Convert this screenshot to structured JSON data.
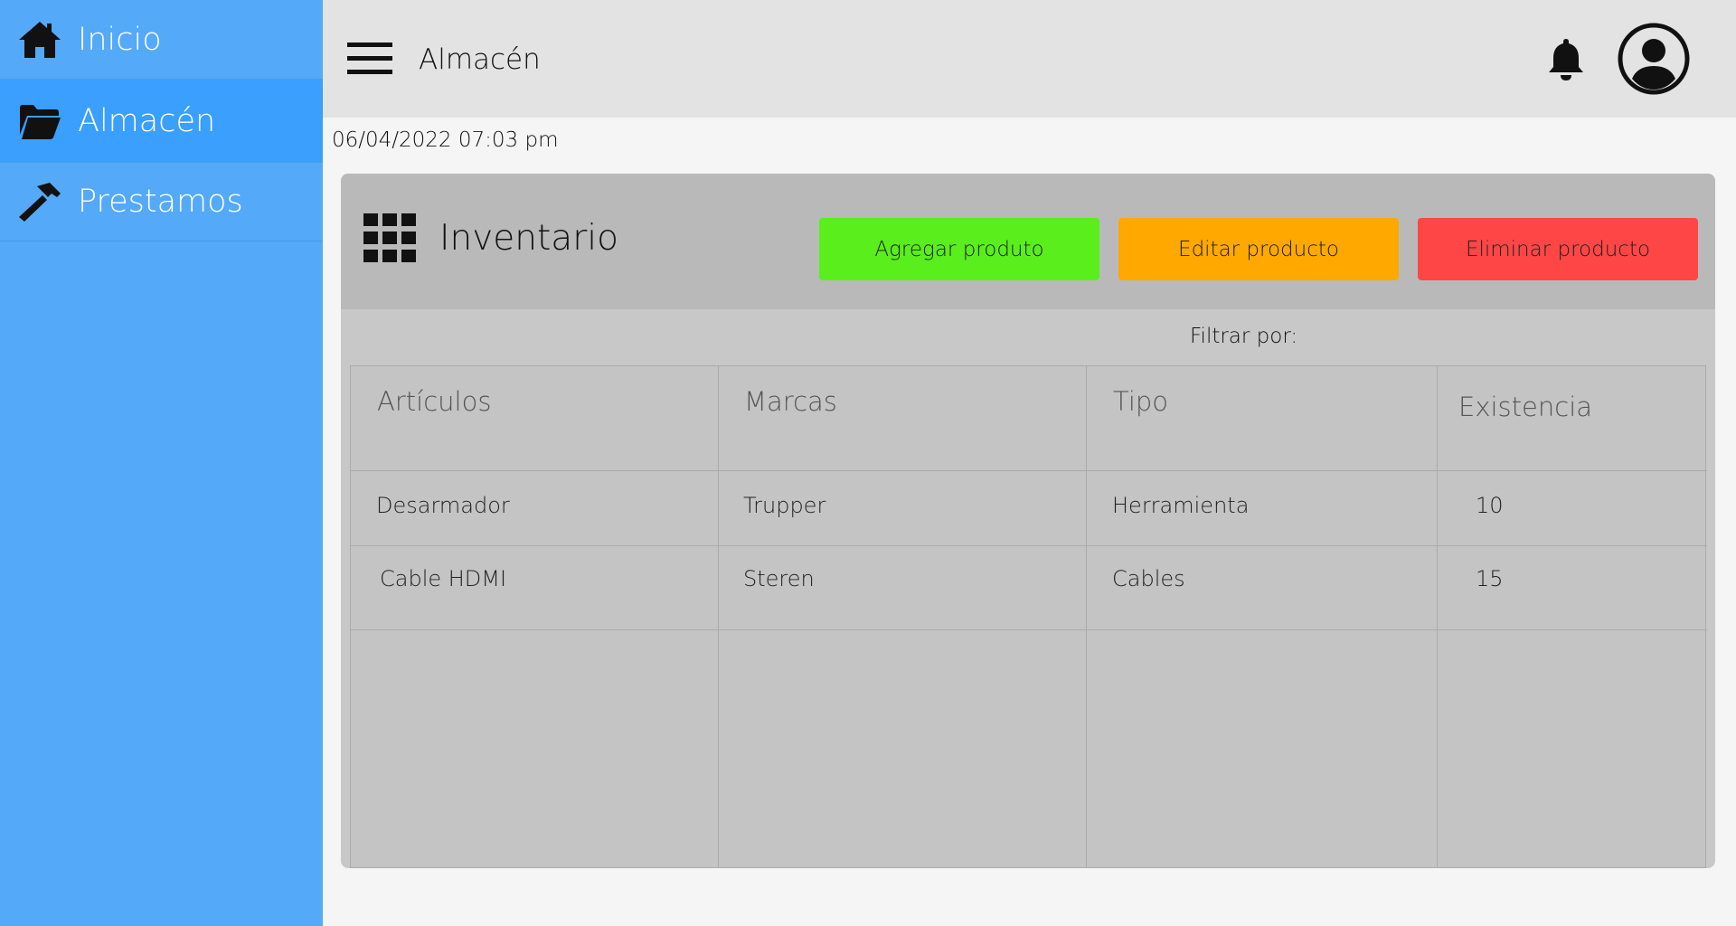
{
  "sidebar": {
    "items": [
      {
        "label": "Inicio",
        "icon": "home-icon",
        "active": false
      },
      {
        "label": "Almacén",
        "icon": "folder-icon",
        "active": true
      },
      {
        "label": "Prestamos",
        "icon": "hammer-icon",
        "active": false
      }
    ]
  },
  "header": {
    "title": "Almacén",
    "menu_icon": "hamburger-icon",
    "notification_icon": "bell-icon",
    "profile_icon": "user-circle-icon"
  },
  "datetime": "06/04/2022 07:03 pm",
  "inventory": {
    "title": "Inventario",
    "icon": "grid-icon",
    "buttons": {
      "add": "Agregar produto",
      "edit": "Editar producto",
      "delete": "Eliminar producto"
    },
    "filter_label": "Filtrar por:",
    "columns": [
      "Artículos",
      "Marcas",
      "Tipo",
      "Existencia"
    ],
    "rows": [
      [
        "Desarmador",
        "Trupper",
        "Herramienta",
        "10"
      ],
      [
        "Cable HDMI",
        "Steren",
        "Cables",
        "15"
      ]
    ]
  },
  "colors": {
    "sidebar": "#54a9f9",
    "sidebar_active": "#3a9ffd",
    "topbar": "#e3e3e3",
    "add_button": "#5aee1c",
    "edit_button": "#ffa800",
    "delete_button": "#fe4646",
    "panel_header": "#b9b9b9",
    "panel_body": "#c8c8c8"
  }
}
